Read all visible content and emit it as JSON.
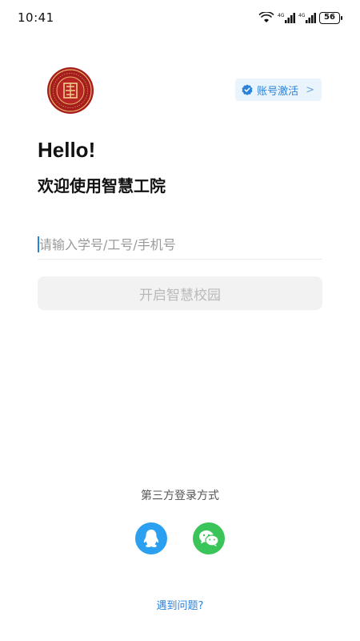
{
  "status_bar": {
    "time": "10:41",
    "battery": "56",
    "icons": [
      "wifi-icon",
      "signal-4g-icon",
      "signal-4g-icon",
      "battery-icon"
    ]
  },
  "header": {
    "logo": "college-seal-logo",
    "activate_label": "账号激活",
    "activate_chevron": ">",
    "hello": "Hello!",
    "welcome": "欢迎使用智慧工院"
  },
  "login": {
    "placeholder": "请输入学号/工号/手机号",
    "value": "",
    "submit_label": "开启智慧校园"
  },
  "third_party": {
    "label": "第三方登录方式",
    "providers": [
      "qq-icon",
      "wechat-icon"
    ]
  },
  "help": {
    "label": "遇到问题?"
  },
  "colors": {
    "accent": "#2b82d9",
    "qq": "#2b9ff0",
    "wechat": "#3bc45a",
    "logo_red": "#a61d1d"
  }
}
